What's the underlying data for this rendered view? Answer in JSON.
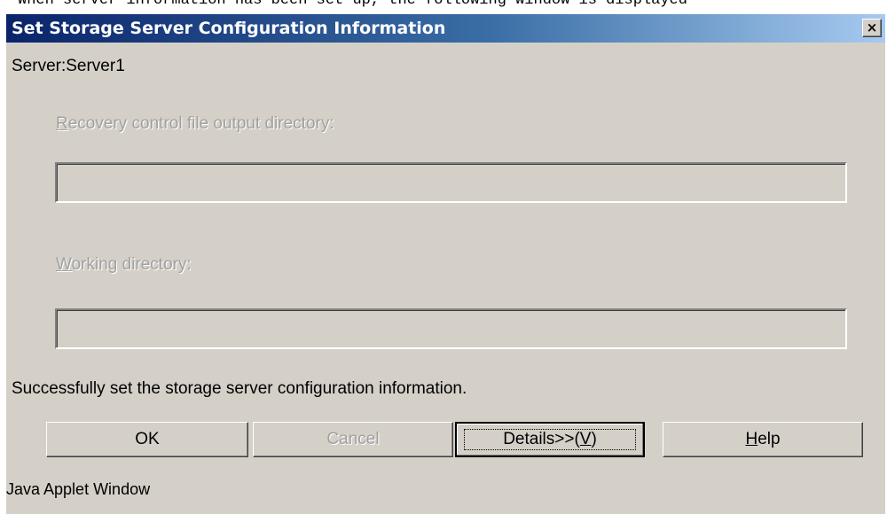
{
  "caption": "When server information has been set up, the following window is displayed",
  "dialog": {
    "title": "Set Storage Server Configuration Information",
    "close_symbol": "×",
    "server_label": "Server:Server1",
    "recovery_label_first": "R",
    "recovery_label_rest": "ecovery control file output directory:",
    "recovery_value": "",
    "working_label_first": "W",
    "working_label_rest": "orking directory:",
    "working_value": "",
    "status_message": "Successfully set the storage server configuration information.",
    "buttons": {
      "ok": "OK",
      "cancel": "Cancel",
      "details_prefix": "Details>>(",
      "details_key": "V",
      "details_suffix": ")",
      "help_key": "H",
      "help_rest": "elp"
    },
    "footer": "Java Applet Window"
  }
}
